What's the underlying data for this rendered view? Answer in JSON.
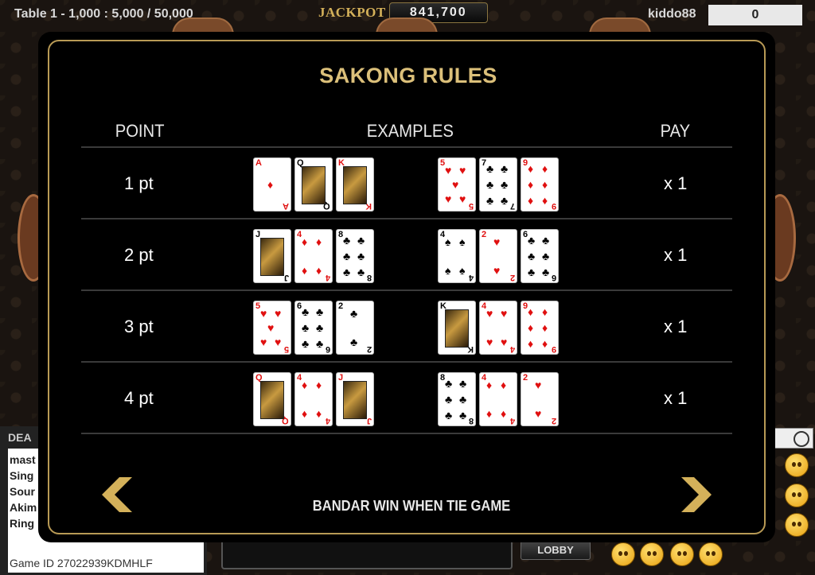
{
  "header": {
    "table_info": "Table 1 - 1,000 : 5,000 / 50,000",
    "jackpot_label": "JACKPOT",
    "jackpot_value": "841,700",
    "username": "kiddo88",
    "balance": "0"
  },
  "side_panel": {
    "dealer_label": "DEA",
    "chat_lines": [
      "mast",
      "Sing",
      "Sour",
      "Akim",
      "Ring"
    ],
    "game_id": "Game ID 27022939KDMHLF",
    "lobby_label": "LOBBY"
  },
  "modal": {
    "title": "SAKONG RULES",
    "headers": {
      "point": "POINT",
      "examples": "EXAMPLES",
      "pay": "PAY"
    },
    "rows": [
      {
        "point": "1 pt",
        "pay": "x 1",
        "cards_a": [
          {
            "rank": "A",
            "suit": "♦",
            "color": "red"
          },
          {
            "rank": "Q",
            "suit": "♣",
            "color": "black",
            "face": true
          },
          {
            "rank": "K",
            "suit": "♥",
            "color": "red",
            "face": true
          }
        ],
        "cards_b": [
          {
            "rank": "5",
            "suit": "♥",
            "color": "red"
          },
          {
            "rank": "7",
            "suit": "♣",
            "color": "black"
          },
          {
            "rank": "9",
            "suit": "♦",
            "color": "red"
          }
        ]
      },
      {
        "point": "2 pt",
        "pay": "x 1",
        "cards_a": [
          {
            "rank": "J",
            "suit": "♣",
            "color": "black",
            "face": true
          },
          {
            "rank": "4",
            "suit": "♦",
            "color": "red"
          },
          {
            "rank": "8",
            "suit": "♣",
            "color": "black"
          }
        ],
        "cards_b": [
          {
            "rank": "4",
            "suit": "♠",
            "color": "black"
          },
          {
            "rank": "2",
            "suit": "♥",
            "color": "red"
          },
          {
            "rank": "6",
            "suit": "♣",
            "color": "black"
          }
        ]
      },
      {
        "point": "3 pt",
        "pay": "x 1",
        "cards_a": [
          {
            "rank": "5",
            "suit": "♥",
            "color": "red"
          },
          {
            "rank": "6",
            "suit": "♣",
            "color": "black"
          },
          {
            "rank": "2",
            "suit": "♣",
            "color": "black"
          }
        ],
        "cards_b": [
          {
            "rank": "K",
            "suit": "♣",
            "color": "black",
            "face": true
          },
          {
            "rank": "4",
            "suit": "♥",
            "color": "red"
          },
          {
            "rank": "9",
            "suit": "♦",
            "color": "red"
          }
        ]
      },
      {
        "point": "4 pt",
        "pay": "x 1",
        "cards_a": [
          {
            "rank": "Q",
            "suit": "♦",
            "color": "red",
            "face": true
          },
          {
            "rank": "4",
            "suit": "♦",
            "color": "red"
          },
          {
            "rank": "J",
            "suit": "♦",
            "color": "red",
            "face": true
          }
        ],
        "cards_b": [
          {
            "rank": "8",
            "suit": "♣",
            "color": "black"
          },
          {
            "rank": "4",
            "suit": "♦",
            "color": "red"
          },
          {
            "rank": "2",
            "suit": "♥",
            "color": "red"
          }
        ]
      }
    ],
    "footer": "BANDAR WIN WHEN TIE GAME"
  }
}
